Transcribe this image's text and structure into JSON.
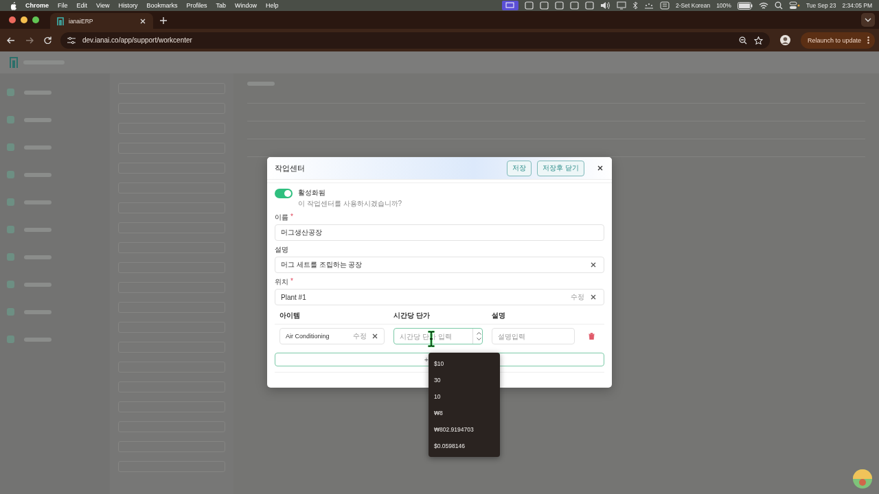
{
  "menu_bar": {
    "app": "Chrome",
    "items": [
      "File",
      "Edit",
      "View",
      "History",
      "Bookmarks",
      "Profiles",
      "Tab",
      "Window",
      "Help"
    ],
    "input_source": "2-Set Korean",
    "battery": "100%",
    "date": "Tue Sep 23",
    "time": "2:34:05 PM"
  },
  "browser": {
    "tab": {
      "title": "ianaiERP"
    },
    "url": "dev.ianai.co/app/support/workcenter",
    "update_button": "Relaunch to update"
  },
  "dialog": {
    "title": "작업센터",
    "buttons": [
      "저장",
      "저장후 닫기"
    ],
    "active_toggle": {
      "on": true,
      "label": "활성화됨",
      "hint": "이 작업센터를 사용하시겠습니까?"
    },
    "fields": [
      {
        "label": "이름",
        "required_mark": "*",
        "value": "머그생산공장",
        "clearable": false
      },
      {
        "label": "설명",
        "value": "머그 세트를 조립하는 공장",
        "clearable": true
      },
      {
        "label": "위치",
        "required_mark": "*",
        "value": "Plant #1",
        "edit_link": "수정",
        "clearable": true
      }
    ],
    "items_table": {
      "columns": [
        "아이템",
        "시간당 단가",
        "설명"
      ],
      "rows": [
        {
          "item": "Air Conditioning",
          "item_edit": "수정",
          "rate_placeholder": "시간당 단가 입력",
          "note_placeholder": "설명입력"
        }
      ],
      "add_row_button": "+"
    }
  },
  "autofill": {
    "options": [
      "$10",
      "30",
      "10",
      "₩8",
      "₩802.9194703",
      "$0.0598146"
    ]
  }
}
